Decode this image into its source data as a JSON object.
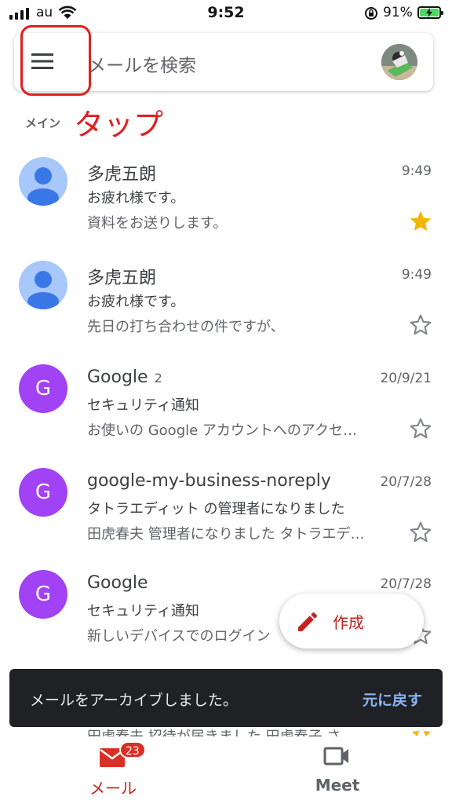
{
  "status_bar": {
    "carrier": "au",
    "time": "9:52",
    "battery": "91%",
    "icons": [
      "signal-icon",
      "wifi-icon",
      "rotation-lock-icon",
      "battery-charging-icon"
    ]
  },
  "search": {
    "placeholder": "メールを検索"
  },
  "annotation": "タップ",
  "section_label": "メイン",
  "mails": [
    {
      "sender": "多虎五朗",
      "count": "",
      "time": "9:49",
      "subject": "お疲れ様です。",
      "snippet": "資料をお送りします。",
      "starred": true,
      "avatar": "person-icon",
      "avatar_letter": ""
    },
    {
      "sender": "多虎五朗",
      "count": "",
      "time": "9:49",
      "subject": "お疲れ様です。",
      "snippet": "先日の打ち合わせの件ですが、",
      "starred": false,
      "avatar": "person-icon",
      "avatar_letter": ""
    },
    {
      "sender": "Google",
      "count": "2",
      "time": "20/9/21",
      "subject": "セキュリティ通知",
      "snippet": "お使いの Google アカウントへのアクセ…",
      "starred": false,
      "avatar": "letter",
      "avatar_letter": "G"
    },
    {
      "sender": "google-my-business-noreply",
      "count": "",
      "time": "20/7/28",
      "subject": "タトラエディット の管理者になりました",
      "snippet": "田虎春夫 管理者になりました タトラエデ…",
      "starred": false,
      "avatar": "letter",
      "avatar_letter": "G"
    },
    {
      "sender": "Google",
      "count": "",
      "time": "20/7/28",
      "subject": "セキュリティ通知",
      "snippet": "新しいデバイスでのログイン",
      "starred": false,
      "avatar": "letter",
      "avatar_letter": "G"
    }
  ],
  "compose": {
    "label": "作成"
  },
  "snackbar": {
    "message": "メールをアーカイブしました。",
    "action": "元に戻す"
  },
  "peek_row": "田虎春夫 招待が届きました 田虎春子 さ…",
  "bottom_nav": {
    "mail_label": "メール",
    "mail_badge": "23",
    "meet_label": "Meet"
  },
  "colors": {
    "accent_red": "#c5221f",
    "star_yellow": "#f4b400",
    "avatar_purple": "#a142f4",
    "avatar_blue": "#a8c7fa",
    "snackbar_bg": "#202124",
    "snackbar_action": "#8ab4f8"
  }
}
